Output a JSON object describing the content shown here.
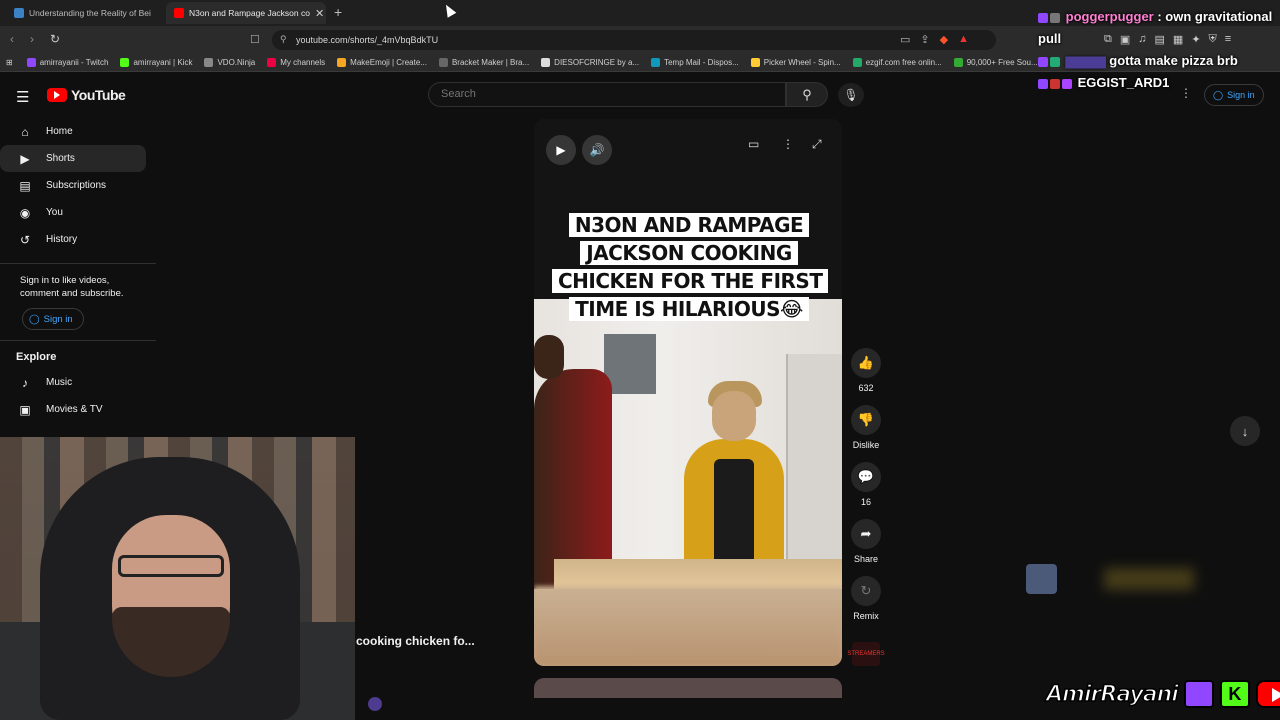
{
  "browser": {
    "tabs": [
      {
        "label": "Understanding the Reality of Bei",
        "active": false
      },
      {
        "label": "N3on and Rampage Jackson co",
        "active": true
      }
    ],
    "url": "youtube.com/shorts/_4mVbqBdkTU",
    "bookmarks": [
      "amirrayanii - Twitch",
      "amirrayani | Kick",
      "VDO.Ninja",
      "My channels",
      "MakeEmoji | Create...",
      "Bracket Maker | Bra...",
      "DIESOFCRINGE by a...",
      "Temp Mail - Dispos...",
      "Picker Wheel - Spin...",
      "ezgif.com free onlin...",
      "90,000+ Free Sou..."
    ]
  },
  "youtube": {
    "logo_text": "YouTube",
    "search_placeholder": "Search",
    "sign_in_label": "Sign in",
    "sidebar": {
      "items": [
        {
          "label": "Home",
          "icon": "home-icon"
        },
        {
          "label": "Shorts",
          "icon": "shorts-icon",
          "active": true
        },
        {
          "label": "Subscriptions",
          "icon": "subscriptions-icon"
        },
        {
          "label": "You",
          "icon": "you-icon"
        },
        {
          "label": "History",
          "icon": "history-icon"
        }
      ],
      "sign_in_prompt": "Sign in to like videos, comment and subscribe.",
      "sign_in_button": "Sign in",
      "explore_title": "Explore",
      "explore_items": [
        {
          "label": "Music",
          "icon": "music-icon"
        },
        {
          "label": "Movies & TV",
          "icon": "movies-icon"
        }
      ]
    },
    "short": {
      "caption": "N3ON AND RAMPAGE JACKSON COOKING CHICKEN FOR THE FIRST TIME IS HILARIOUS😂",
      "title_truncated": "cooking chicken fo...",
      "actions": {
        "likes": "632",
        "dislike_label": "Dislike",
        "comments": "16",
        "share_label": "Share",
        "remix_label": "Remix"
      },
      "channel_avatar_text": "STREAMERS"
    }
  },
  "chat": [
    {
      "user": "poggerpugger",
      "message": "own gravitational pull"
    },
    {
      "user": "",
      "message": "gotta make pizza brb"
    },
    {
      "user": "EGGIST_ARD1",
      "message": ""
    }
  ],
  "brand": {
    "name": "AmirRayani",
    "k_letter": "K"
  }
}
